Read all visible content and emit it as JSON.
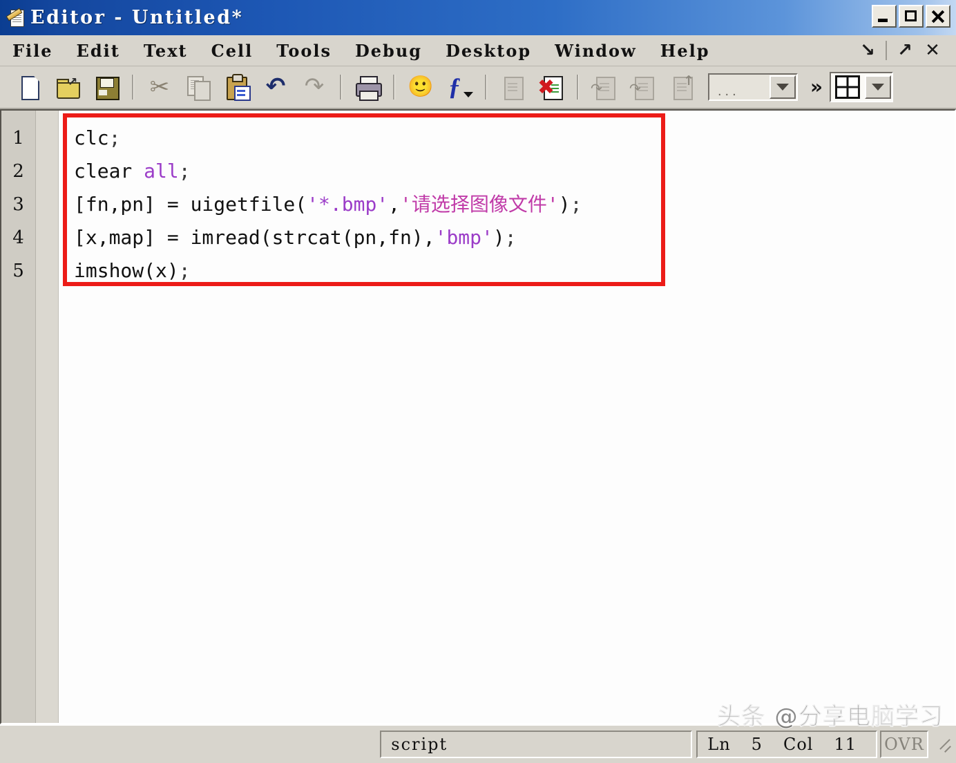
{
  "window": {
    "title": "Editor - Untitled*",
    "icon": "editor-document-pencil-icon",
    "controls": {
      "minimize": "_",
      "maximize": "□",
      "close": "✕"
    }
  },
  "menubar": {
    "items": [
      {
        "label": "File"
      },
      {
        "label": "Edit"
      },
      {
        "label": "Text"
      },
      {
        "label": "Cell"
      },
      {
        "label": "Tools"
      },
      {
        "label": "Debug"
      },
      {
        "label": "Desktop"
      },
      {
        "label": "Window"
      },
      {
        "label": "Help"
      }
    ],
    "right_icons": [
      {
        "name": "dock-arrow-icon",
        "glyph": "↘"
      },
      {
        "name": "undock-arrow-icon",
        "glyph": "↗"
      },
      {
        "name": "close-document-icon",
        "glyph": "✕"
      }
    ]
  },
  "toolbar": {
    "buttons": [
      {
        "name": "new-file-icon",
        "tooltip": "New"
      },
      {
        "name": "open-file-icon",
        "tooltip": "Open"
      },
      {
        "name": "save-file-icon",
        "tooltip": "Save"
      },
      {
        "name": "cut-icon",
        "tooltip": "Cut"
      },
      {
        "name": "copy-icon",
        "tooltip": "Copy"
      },
      {
        "name": "paste-icon",
        "tooltip": "Paste"
      },
      {
        "name": "undo-icon",
        "tooltip": "Undo"
      },
      {
        "name": "redo-icon",
        "tooltip": "Redo"
      },
      {
        "name": "print-icon",
        "tooltip": "Print"
      },
      {
        "name": "find-icon",
        "tooltip": "Find"
      },
      {
        "name": "function-browser-icon",
        "tooltip": "Function Browser"
      },
      {
        "name": "set-breakpoint-icon",
        "tooltip": "Set/Clear Breakpoint"
      },
      {
        "name": "clear-breakpoints-icon",
        "tooltip": "Clear All Breakpoints"
      },
      {
        "name": "step-icon",
        "tooltip": "Step"
      },
      {
        "name": "step-in-icon",
        "tooltip": "Step In"
      },
      {
        "name": "step-out-icon",
        "tooltip": "Step Out"
      }
    ],
    "stack_combo_value": "...",
    "overflow_label": "»",
    "layout_icon": "split-pane-icon"
  },
  "editor": {
    "line_numbers": [
      "1",
      "2",
      "3",
      "4",
      "5"
    ],
    "lines": [
      {
        "number": "1",
        "tokens": [
          {
            "text": "clc",
            "type": "plain"
          },
          {
            "text": ";",
            "type": "punct"
          }
        ]
      },
      {
        "number": "2",
        "tokens": [
          {
            "text": "clear ",
            "type": "plain"
          },
          {
            "text": "all",
            "type": "keyword"
          },
          {
            "text": ";",
            "type": "punct"
          }
        ]
      },
      {
        "number": "3",
        "tokens": [
          {
            "text": "[fn,pn] = uigetfile(",
            "type": "plain"
          },
          {
            "text": "'*.bmp'",
            "type": "string"
          },
          {
            "text": ",",
            "type": "plain"
          },
          {
            "text": "'请选择图像文件'",
            "type": "cjk-string"
          },
          {
            "text": ")",
            "type": "plain"
          },
          {
            "text": ";",
            "type": "punct"
          }
        ]
      },
      {
        "number": "4",
        "tokens": [
          {
            "text": "[x,map] = imread(strcat(pn,fn),",
            "type": "plain"
          },
          {
            "text": "'bmp'",
            "type": "string"
          },
          {
            "text": ")",
            "type": "plain"
          },
          {
            "text": ";",
            "type": "punct"
          }
        ]
      },
      {
        "number": "5",
        "tokens": [
          {
            "text": "imshow(x)",
            "type": "plain"
          },
          {
            "text": ";",
            "type": "punct"
          }
        ]
      }
    ],
    "highlight_box_color": "#ec1c18"
  },
  "statusbar": {
    "file_type": "script",
    "line_label": "Ln",
    "line_value": "5",
    "col_label": "Col",
    "col_value": "11",
    "overwrite_mode": "OVR"
  },
  "watermark": {
    "text": "头条 @分享电脑学习"
  },
  "colors": {
    "title_gradient_start": "#0b3d91",
    "title_gradient_end": "#c3d8f2",
    "chrome": "#d8d5cd",
    "string_purple": "#9b3cc8",
    "cjk_magenta": "#c03aa8",
    "highlight_red": "#ec1c18"
  }
}
